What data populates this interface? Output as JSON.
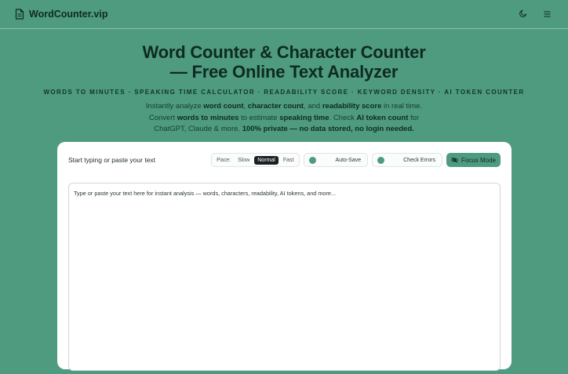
{
  "brand": {
    "name": "WordCounter.vip",
    "icon": "document-icon"
  },
  "nav": {
    "theme_icon": "moon-icon",
    "menu_icon": "hamburger-menu-icon"
  },
  "hero": {
    "title": "Word Counter & Character Counter — Free Online Text Analyzer",
    "subtitle": "WORDS TO MINUTES · SPEAKING TIME CALCULATOR · READABILITY SCORE · KEYWORD DENSITY · AI TOKEN COUNTER",
    "desc": {
      "p1": "Instantly analyze ",
      "b1": "word count",
      "p2": ", ",
      "b2": "character count",
      "p3": ", and ",
      "b3": "readability score",
      "p4": " in real time. Convert ",
      "b4": "words to minutes",
      "p5": " to estimate ",
      "b5": "speaking time",
      "p6": ". Check ",
      "b6": "AI token count",
      "p7": " for ChatGPT, Claude & more. ",
      "b7": "100% private — no data stored, no login needed."
    }
  },
  "editor": {
    "label": "Start typing or paste your text",
    "pace": {
      "label": "Pace:",
      "options": [
        "Slow",
        "Normal",
        "Fast"
      ],
      "selected": "Normal"
    },
    "autosave_label": "Auto-Save",
    "check_errors_label": "Check Errors",
    "focus_mode_label": "Focus Mode",
    "focus_icon": "eye-off-icon",
    "placeholder": "Type or paste your text here for instant analysis — words, characters, readability, AI tokens, and more..."
  },
  "colors": {
    "background": "#4e9b7f",
    "card": "#ffffff",
    "accent": "#4e9b7f",
    "dark": "#0f2a22"
  }
}
